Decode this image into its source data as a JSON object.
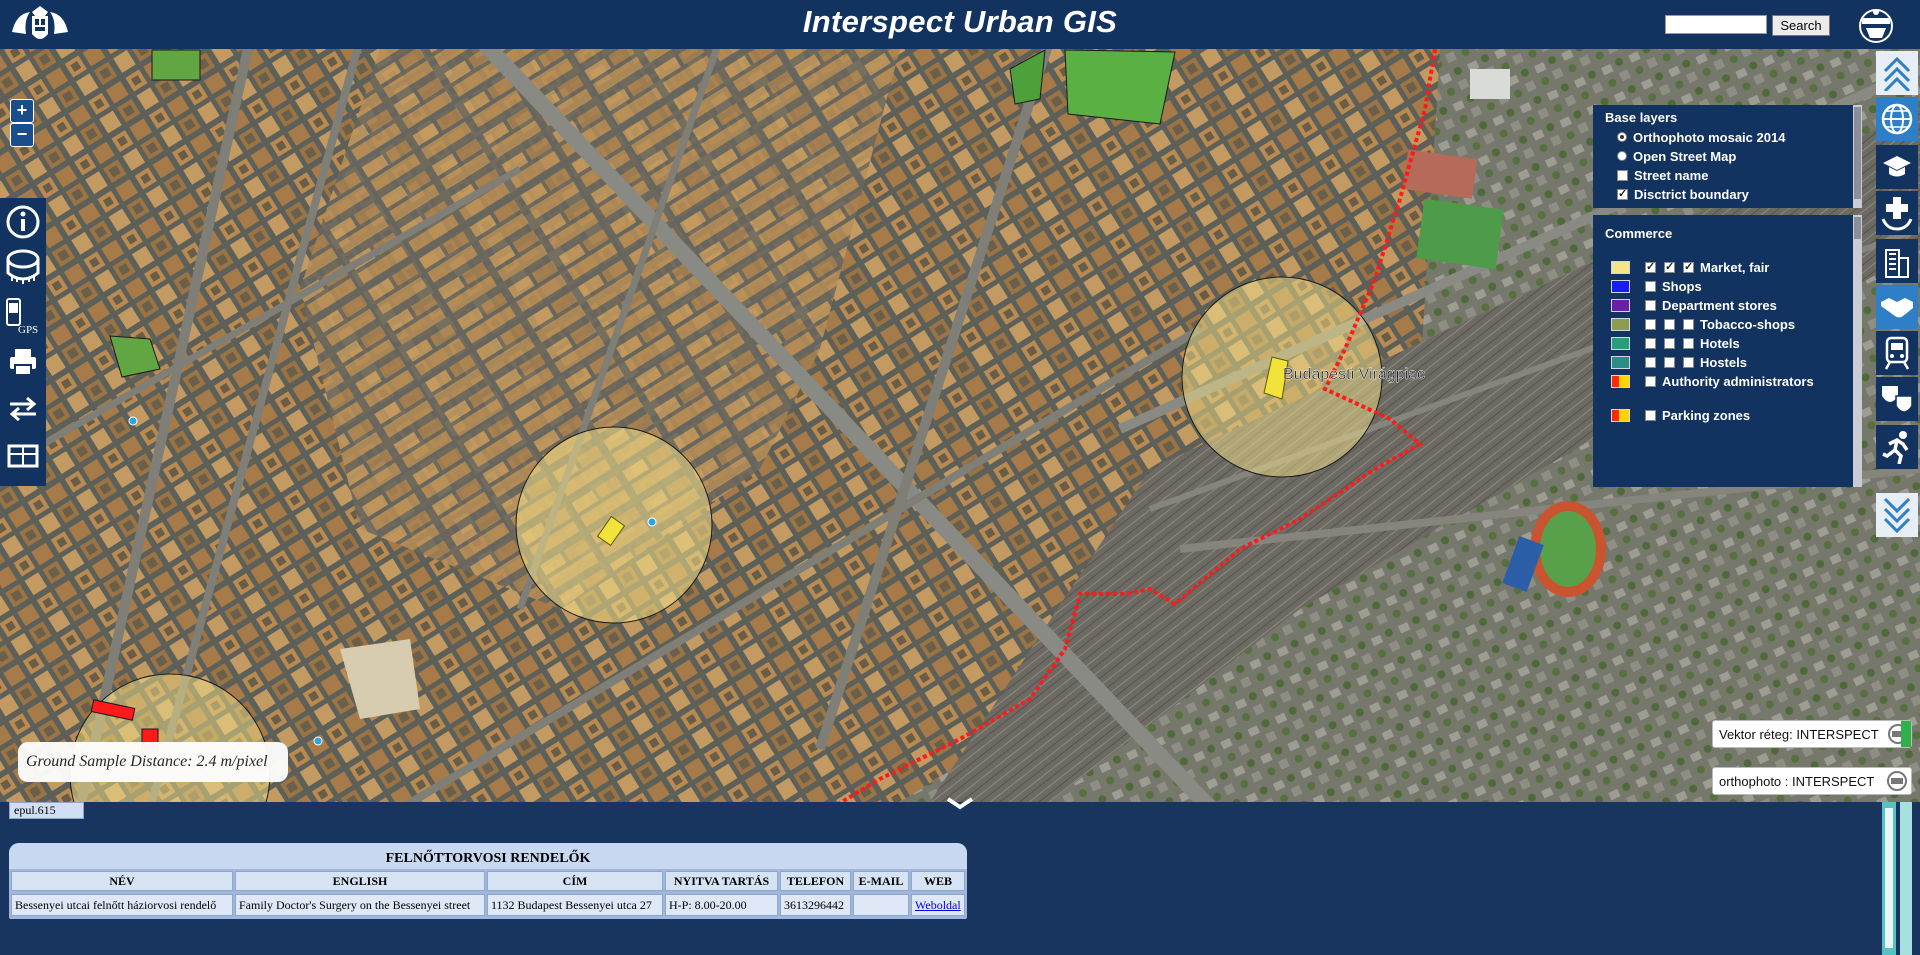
{
  "header": {
    "title": "Interspect Urban GIS",
    "search_placeholder": "",
    "search_button": "Search"
  },
  "map": {
    "district_label": "Budapesti Virágpiac",
    "gsd_text": "Ground Sample Distance: 2.4 m/pixel",
    "zoom_in": "+",
    "zoom_out": "−"
  },
  "left_tools": {
    "gps_label": "GPS",
    "icons": [
      "info-icon",
      "measure-tape-icon",
      "gps-phone-icon",
      "print-icon",
      "swap-arrows-icon",
      "map-frame-icon"
    ]
  },
  "right_toolbar": {
    "icons": [
      "scroll-up-icon",
      "globe-icon",
      "education-icon",
      "health-icon",
      "building-icon",
      "handshake-icon",
      "train-icon",
      "theatre-masks-icon",
      "runner-icon",
      "scroll-down-icon"
    ]
  },
  "base_layers": {
    "title": "Base layers",
    "options": [
      {
        "label": "Orthophoto mosaic 2014",
        "type": "radio",
        "checked": true
      },
      {
        "label": "Open Street Map",
        "type": "radio",
        "checked": false
      },
      {
        "label": "Street name",
        "type": "checkbox",
        "checked": false
      },
      {
        "label": "Disctrict boundary",
        "type": "checkbox",
        "checked": true
      }
    ]
  },
  "commerce": {
    "title": "Commerce",
    "items": [
      {
        "label": "Market, fair",
        "color": "#f4e58a",
        "checks": [
          true,
          true,
          true
        ]
      },
      {
        "label": "Shops",
        "color": "#1a1aff",
        "checks": [
          false
        ]
      },
      {
        "label": "Department stores",
        "color": "#6a1fa8",
        "checks": [
          false
        ]
      },
      {
        "label": "Tobacco-shops",
        "color": "#8c9c52",
        "checks": [
          false,
          false,
          false
        ]
      },
      {
        "label": "Hotels",
        "color": "#2a9c7a",
        "checks": [
          false,
          false,
          false
        ]
      },
      {
        "label": "Hostels",
        "color": "#2a8c82",
        "checks": [
          false,
          false,
          false
        ]
      },
      {
        "label": "Authority administrators",
        "color": "#ff2a00",
        "checks": [
          false
        ]
      },
      {
        "label": "Parking zones",
        "color": "#ff2a00",
        "checks": [
          false
        ]
      }
    ]
  },
  "badges": {
    "vector": "Vektor réteg: INTERSPECT",
    "ortho": "orthophoto : INTERSPECT"
  },
  "bottom": {
    "feature_id": "epul.615",
    "table_title": "FELNŐTTORVOSI RENDELŐK",
    "columns": [
      "NÉV",
      "ENGLISH",
      "CÍM",
      "NYITVA TARTÁS",
      "TELEFON",
      "E-MAIL",
      "WEB"
    ],
    "row": {
      "nev": "Bessenyei utcai felnőtt háziorvosi rendelő",
      "english": "Family Doctor's Surgery on the Bessenyei street",
      "cim": "1132 Budapest Bessenyei utca 27",
      "nyitva": "H-P: 8.00-20.00",
      "telefon": "3613296442",
      "email": "",
      "web": "Weboldal"
    }
  },
  "colors": {
    "header_bg": "#12325f",
    "panel_bg": "#12325f",
    "boundary_red": "#ff1a1a",
    "highlight_yellow": "#f2e23a"
  }
}
